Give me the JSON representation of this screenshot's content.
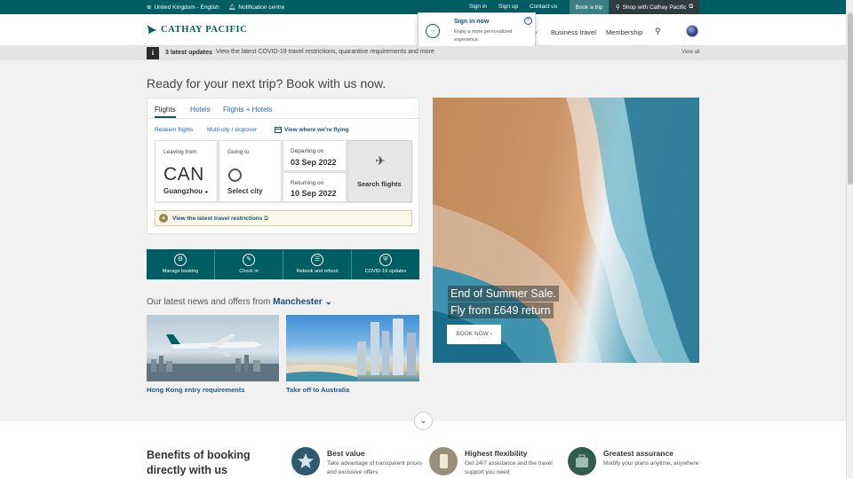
{
  "utility": {
    "language": "United Kingdom - English",
    "notification": "Notification centre",
    "sign_in": "Sign in",
    "sign_up": "Sign up",
    "contact": "Contact us",
    "book_trip": "Book a trip",
    "shop": "Shop with Cathay Pacific"
  },
  "header": {
    "logo_text": "CATHAY PACIFIC",
    "nav_partial": "e",
    "nav": [
      "Business travel",
      "Membership"
    ]
  },
  "popup": {
    "title": "Sign in now",
    "description": "Enjoy a more personalized experience."
  },
  "updates": {
    "count": "3 latest updates",
    "message": "View the latest COVID-19 travel restrictions, quarantine requirements and more",
    "view_all": "View all"
  },
  "headline": "Ready for your next trip? Book with us now.",
  "booking": {
    "tabs": [
      "Flights",
      "Hotels",
      "Flights + Hotels"
    ],
    "sublinks": [
      "Redeem flights",
      "Multi-city / stopover"
    ],
    "where_flying": "View where we're flying",
    "from_label": "Leaving from",
    "from_code": "CAN",
    "from_city": "Guangzhou",
    "to_label": "Going to",
    "to_city": "Select city",
    "depart_label": "Departing on",
    "depart_date": "03 Sep 2022",
    "return_label": "Returning on",
    "return_date": "10 Sep 2022",
    "search": "Search flights",
    "restrictions": "View the latest travel restrictions"
  },
  "quick_actions": [
    "Manage booking",
    "Check in",
    "Rebook and refund",
    "COVID-19 updates"
  ],
  "news": {
    "heading": "Our latest news and offers from",
    "city": "Manchester",
    "items": [
      "Hong Kong entry requirements",
      "Take off to Australia"
    ]
  },
  "hero": {
    "line1": "End of Summer Sale.",
    "line2": "Fly from £649 return",
    "cta": "BOOK NOW"
  },
  "benefits": {
    "title": "Benefits of booking directly with us",
    "items": [
      {
        "title": "Best value",
        "desc": "Take advantage of transparent prices and exclusive offers"
      },
      {
        "title": "Highest flexibility",
        "desc": "Get 24/7 assistance and the travel support you need"
      },
      {
        "title": "Greatest assurance",
        "desc": "Modify your plans anytime, anywhere"
      }
    ]
  },
  "colors": {
    "brand": "#005d63",
    "link": "#1a4d7a"
  }
}
